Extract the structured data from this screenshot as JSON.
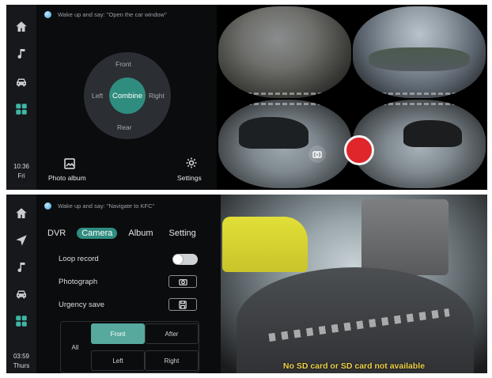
{
  "panel1": {
    "sidebar": {
      "icons": [
        "home-icon",
        "music-icon",
        "car-icon",
        "apps-icon"
      ],
      "time": "10:36",
      "day": "Fri"
    },
    "voice_hint": "Wake up and say: \"Open the car window\"",
    "view_selector": {
      "front": "Front",
      "rear": "Rear",
      "left": "Left",
      "right": "Right",
      "center": "Combine"
    },
    "photo_album_label": "Photo album",
    "settings_label": "Settings",
    "camera_views": [
      "front",
      "rear",
      "left",
      "right"
    ]
  },
  "panel2": {
    "sidebar": {
      "icons": [
        "home-icon",
        "navigation-icon",
        "music-icon",
        "car-icon",
        "apps-icon"
      ],
      "time": "03:59",
      "day": "Thurs"
    },
    "voice_hint": "Wake up and say: \"Navigate to KFC\"",
    "tabs": [
      {
        "label": "DVR",
        "active": false
      },
      {
        "label": "Camera",
        "active": true
      },
      {
        "label": "Album",
        "active": false
      },
      {
        "label": "Setting",
        "active": false
      }
    ],
    "loop_record_label": "Loop record",
    "loop_record_on": false,
    "photograph_label": "Photograph",
    "urgency_save_label": "Urgency save",
    "camera_grid": {
      "all": "All",
      "front": "Front",
      "after": "After",
      "left": "Left",
      "right": "Right",
      "selected": "Front"
    },
    "sd_message": "No SD card or SD card not available"
  },
  "colors": {
    "accent": "#2f8d80",
    "record": "#e0262b",
    "warning_text": "#f0d24a",
    "background": "#0b0c0e"
  }
}
